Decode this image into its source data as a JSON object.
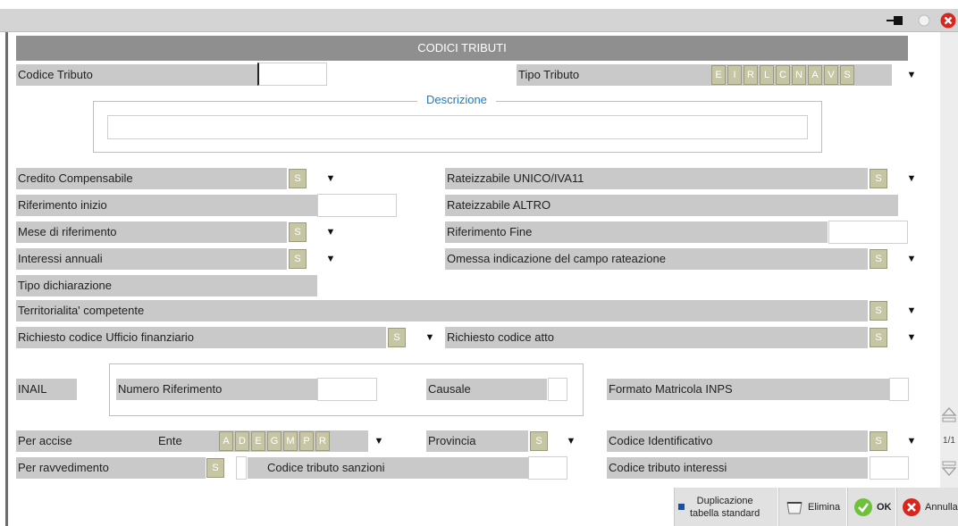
{
  "window": {
    "title": "CODICI TRIBUTI",
    "buttons": {
      "pin_icon": "pin-icon",
      "minimize_icon": "circle-icon",
      "close_icon": "close-icon"
    }
  },
  "form": {
    "codice_tributo_label": "Codice Tributo",
    "codice_tributo_value": "",
    "tipo_tributo_label": "Tipo Tributo",
    "tipo_tributo_options": [
      "E",
      "I",
      "R",
      "L",
      "C",
      "N",
      "A",
      "V",
      "S"
    ],
    "descrizione_label": "Descrizione",
    "descrizione_value": "",
    "credito_compensabile_label": "Credito Compensabile",
    "credito_compensabile_value": "S",
    "rateizzabile_unico_label": "Rateizzabile UNICO/IVA11",
    "rateizzabile_unico_value": "S",
    "riferimento_inizio_label": "Riferimento inizio",
    "rateizzabile_altro_label": "Rateizzabile ALTRO",
    "mese_riferimento_label": "Mese di riferimento",
    "mese_riferimento_value": "S",
    "riferimento_fine_label": "Riferimento Fine",
    "interessi_annuali_label": "Interessi annuali",
    "interessi_annuali_value": "S",
    "omessa_label": "Omessa indicazione del campo rateazione",
    "omessa_value": "S",
    "tipo_dichiarazione_label": "Tipo dichiarazione",
    "territorialita_label": "Territorialita' competente",
    "territorialita_value": "S",
    "ufficio_label": "Richiesto codice Ufficio finanziario",
    "ufficio_value": "S",
    "atto_label": "Richiesto codice atto",
    "atto_value": "S",
    "inail_label": "INAIL",
    "numero_riferimento_label": "Numero Riferimento",
    "causale_label": "Causale",
    "formato_matricola_label": "Formato Matricola INPS",
    "per_accise_label": "Per accise",
    "ente_label": "Ente",
    "ente_options": [
      "A",
      "D",
      "E",
      "G",
      "M",
      "P",
      "R"
    ],
    "provincia_label": "Provincia",
    "provincia_value": "S",
    "codice_identificativo_label": "Codice Identificativo",
    "codice_identificativo_value": "S",
    "per_ravvedimento_label": "Per ravvedimento",
    "per_ravvedimento_value": "S",
    "codice_sanzioni_label": "Codice tributo sanzioni",
    "codice_interessi_label": "Codice tributo interessi"
  },
  "scrollbar": {
    "page_indicator": "1/1"
  },
  "footer": {
    "duplicazione_line1": "Duplicazione",
    "duplicazione_line2": "tabella standard",
    "elimina_label": "Elimina",
    "ok_label": "OK",
    "annulla_label": "Annulla"
  },
  "colors": {
    "header_bg": "#8f8f8f",
    "label_bg": "#c9c9c9",
    "legend_color": "#1f7ac0",
    "ok_green": "#6ec23a",
    "cancel_red": "#d8261f"
  }
}
